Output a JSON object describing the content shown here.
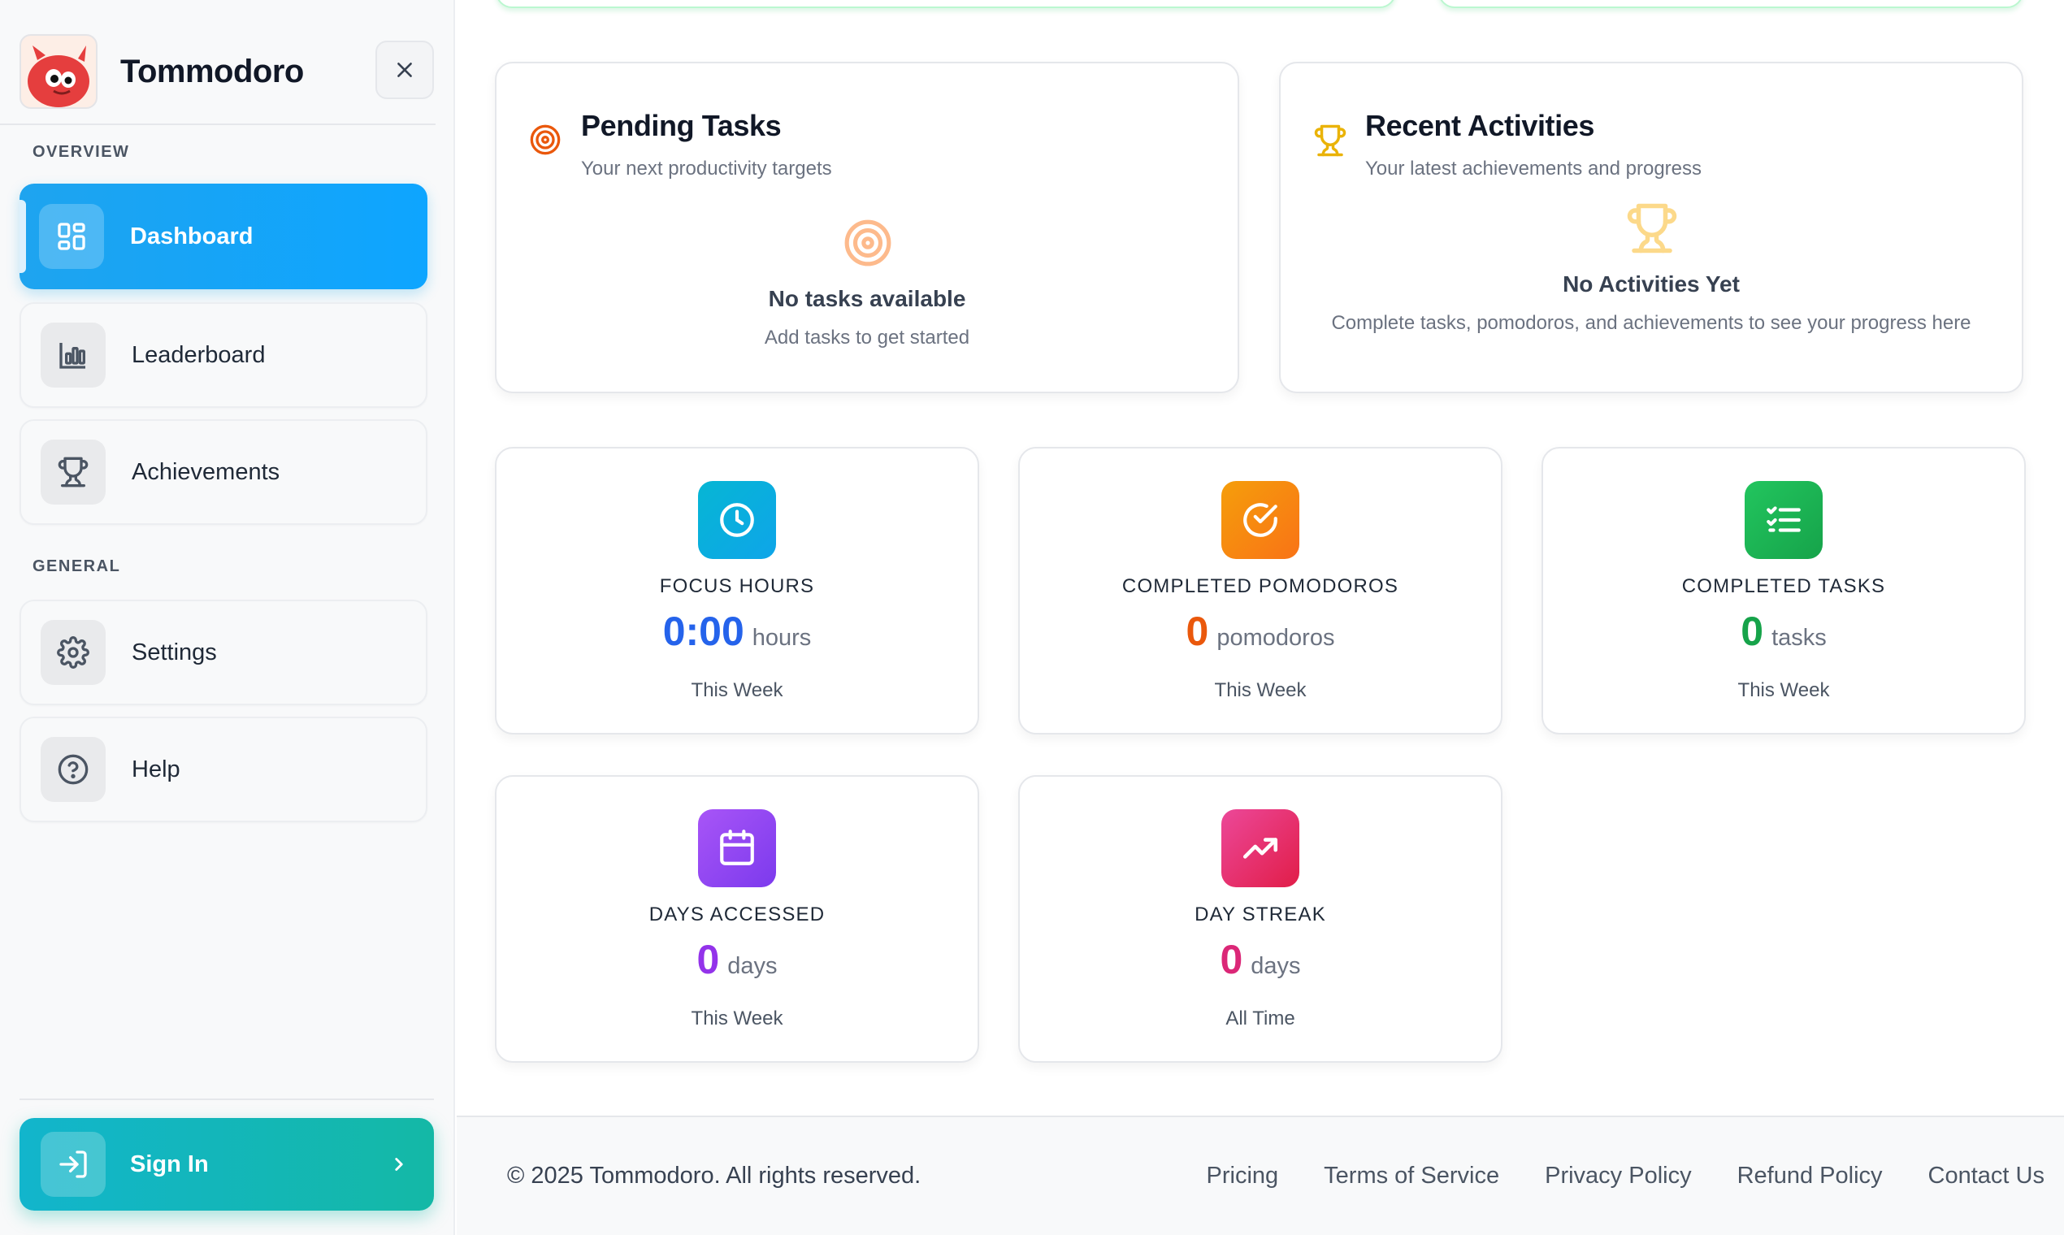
{
  "app": {
    "name": "Tommodoro"
  },
  "sidebar": {
    "overview_label": "OVERVIEW",
    "general_label": "GENERAL",
    "items": [
      {
        "label": "Dashboard",
        "icon": "grid-icon",
        "active": true
      },
      {
        "label": "Leaderboard",
        "icon": "bar-chart-icon"
      },
      {
        "label": "Achievements",
        "icon": "trophy-icon"
      },
      {
        "label": "Settings",
        "icon": "gear-icon"
      },
      {
        "label": "Help",
        "icon": "help-circle-icon"
      }
    ],
    "signin_label": "Sign In"
  },
  "pending": {
    "title": "Pending Tasks",
    "subtitle": "Your next productivity targets",
    "empty_title": "No tasks available",
    "empty_sub": "Add tasks to get started"
  },
  "activities": {
    "title": "Recent Activities",
    "subtitle": "Your latest achievements and progress",
    "empty_title": "No Activities Yet",
    "empty_sub": "Complete tasks, pomodoros, and achievements to see your progress here"
  },
  "stats": [
    {
      "label": "FOCUS HOURS",
      "value": "0:00",
      "unit": "hours",
      "period": "This Week",
      "color": "#2563eb",
      "icon": "clock-icon"
    },
    {
      "label": "COMPLETED POMODOROS",
      "value": "0",
      "unit": "pomodoros",
      "period": "This Week",
      "color": "#ea580c",
      "icon": "check-circle-icon"
    },
    {
      "label": "COMPLETED TASKS",
      "value": "0",
      "unit": "tasks",
      "period": "This Week",
      "color": "#16a34a",
      "icon": "checklist-icon"
    },
    {
      "label": "DAYS ACCESSED",
      "value": "0",
      "unit": "days",
      "period": "This Week",
      "color": "#9333ea",
      "icon": "calendar-icon"
    },
    {
      "label": "DAY STREAK",
      "value": "0",
      "unit": "days",
      "period": "All Time",
      "color": "#db2777",
      "icon": "trending-up-icon"
    }
  ],
  "footer": {
    "copyright": "© 2025 Tommodoro. All rights reserved.",
    "links": [
      "Pricing",
      "Terms of Service",
      "Privacy Policy",
      "Refund Policy",
      "Contact Us"
    ]
  }
}
